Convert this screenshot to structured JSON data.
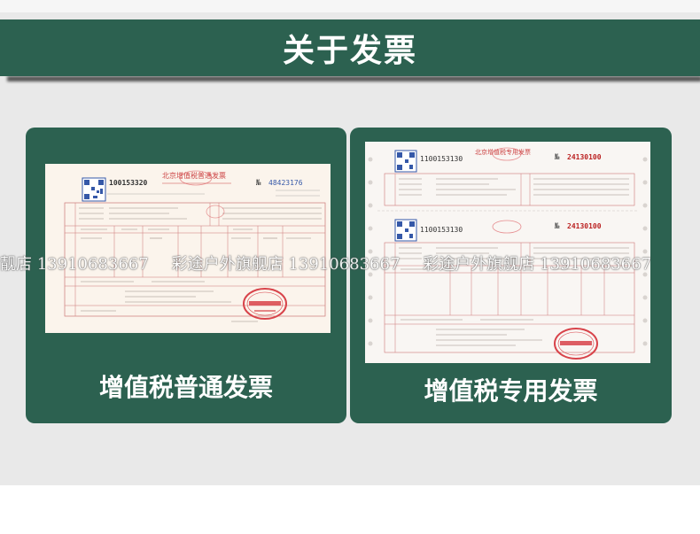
{
  "header": {
    "title": "关于发票"
  },
  "cards": [
    {
      "caption": "增值税普通发票",
      "invoice_number": "100153320",
      "invoice_no_label": "№",
      "invoice_no_value": "48423176",
      "invoice_heading": "北京增值税普通发票"
    },
    {
      "caption": "增值税专用发票",
      "invoice_number_top": "1100153130",
      "invoice_number_bottom": "1100153130",
      "invoice_no_label": "№",
      "invoice_no_value_top": "24130100",
      "invoice_no_value_bottom": "24130100",
      "invoice_heading": "北京增值税专用发票"
    }
  ],
  "watermark": {
    "segments": [
      "靓店 13910683667",
      "彩途户外旗舰店 13910683667",
      "彩途户外旗舰店 13910683667"
    ]
  },
  "colors": {
    "brand_green": "#2c6150",
    "panel_gray": "#e9e9e9",
    "stamp_red": "#d8434a",
    "qr_blue": "#3558a8"
  }
}
